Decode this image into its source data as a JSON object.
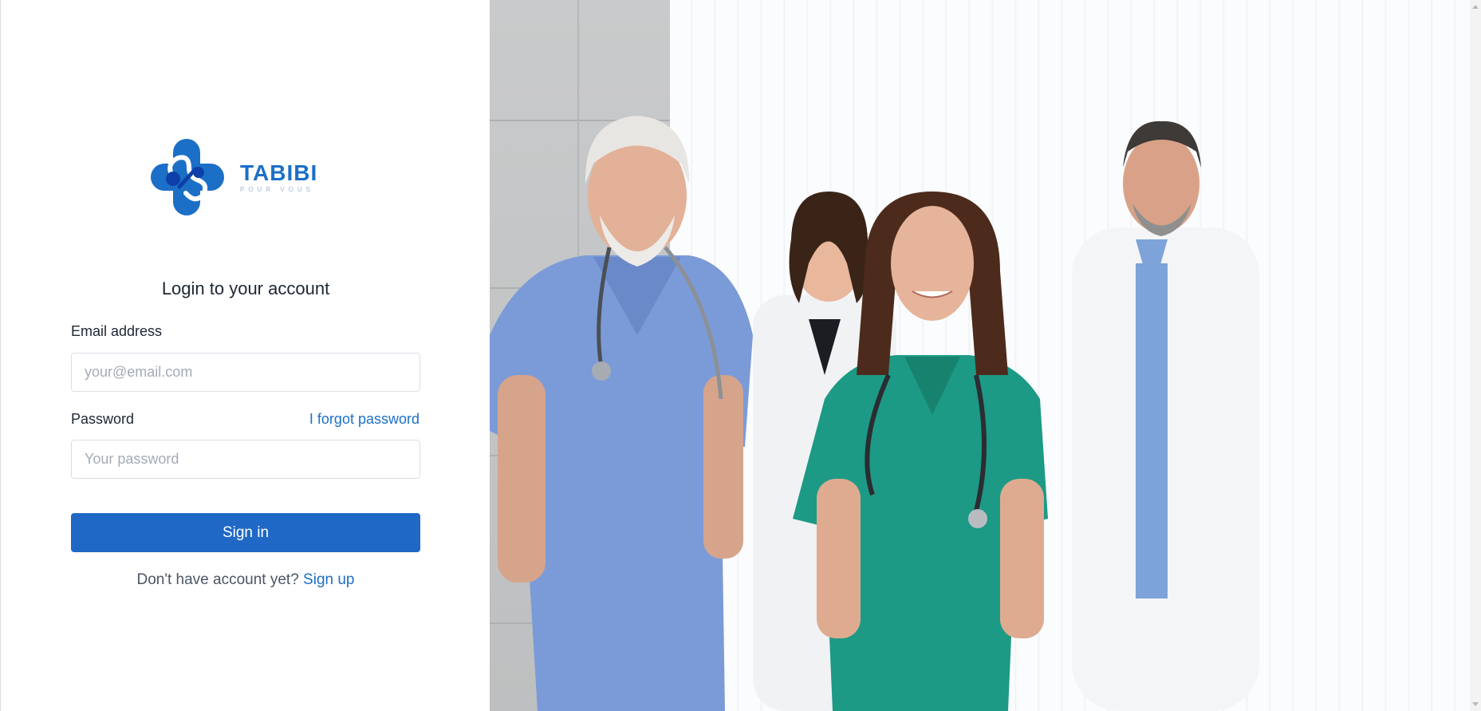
{
  "brand": {
    "name": "TABIBI",
    "tagline": "POUR VOUS",
    "colors": {
      "primary": "#1c6fc6",
      "dark": "#0d3fa8",
      "accent": "#1f68c6"
    }
  },
  "login": {
    "title": "Login to your account",
    "email_label": "Email address",
    "email_placeholder": "your@email.com",
    "password_label": "Password",
    "password_placeholder": "Your password",
    "forgot_link": "I forgot password",
    "submit_label": "Sign in",
    "signup_prompt": "Don't have account yet?",
    "signup_link": "Sign up"
  },
  "hero": {
    "description_icon": "medical-team-photo"
  }
}
